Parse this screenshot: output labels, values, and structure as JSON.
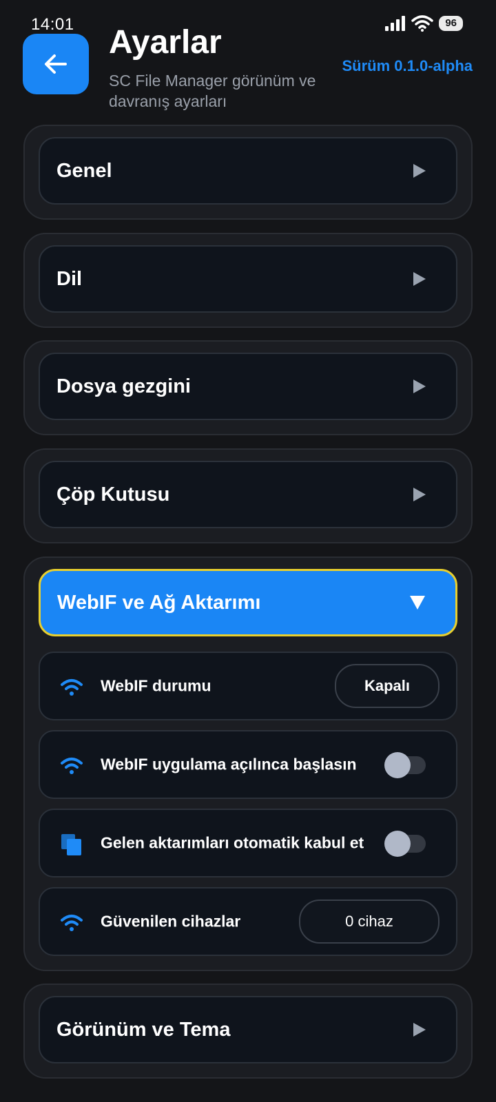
{
  "status_bar": {
    "time": "14:01",
    "battery": "96",
    "icons": [
      "signal-icon",
      "wifi-icon",
      "battery-icon"
    ]
  },
  "header": {
    "back_icon": "arrow-left-icon",
    "title": "Ayarlar",
    "subtitle": "SC File Manager görünüm ve davranış ayarları",
    "version": "Sürüm 0.1.0-alpha"
  },
  "sections": {
    "general": {
      "label": "Genel"
    },
    "language": {
      "label": "Dil"
    },
    "file_browser": {
      "label": "Dosya gezgini"
    },
    "trash": {
      "label": "Çöp Kutusu"
    },
    "webif": {
      "label": "WebIF ve Ağ Aktarımı",
      "expanded": true,
      "items": [
        {
          "icon": "wifi-icon",
          "label": "WebIF durumu",
          "control": "button",
          "value": "Kapalı"
        },
        {
          "icon": "wifi-icon",
          "label": "WebIF uygulama açılınca başlasın",
          "control": "toggle",
          "on": false
        },
        {
          "icon": "copy-icon",
          "label": "Gelen aktarımları otomatik kabul et",
          "control": "toggle",
          "on": false
        },
        {
          "icon": "wifi-icon",
          "label": "Güvenilen cihazlar",
          "control": "button",
          "value": "0 cihaz"
        }
      ]
    },
    "appearance": {
      "label": "Görünüm ve Tema"
    }
  },
  "colors": {
    "accent": "#1a86f5",
    "background": "#141518",
    "highlight_border": "#e8cf2e"
  }
}
